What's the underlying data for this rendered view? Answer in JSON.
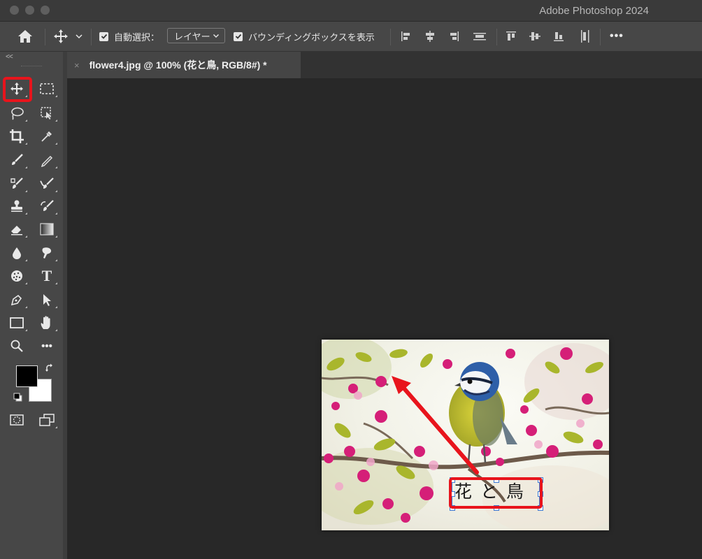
{
  "window": {
    "title": "Adobe Photoshop 2024"
  },
  "options_bar": {
    "auto_select_label": "自動選択：",
    "auto_select_target": "レイヤー",
    "bounding_box_label": "バウンディングボックスを表示",
    "more_label": "•••"
  },
  "document": {
    "tab_title": "flower4.jpg @ 100% (花と鳥, RGB/8#) *",
    "text_layer": "花 と 鳥"
  },
  "toolbar": {
    "collapse_label": "<<",
    "more_tools_label": "•••",
    "type_tool_label": "T"
  },
  "colors": {
    "accent_highlight": "#e8141c",
    "foreground": "#000000",
    "background": "#ffffff",
    "selection_handles": "#3d7bd4"
  }
}
